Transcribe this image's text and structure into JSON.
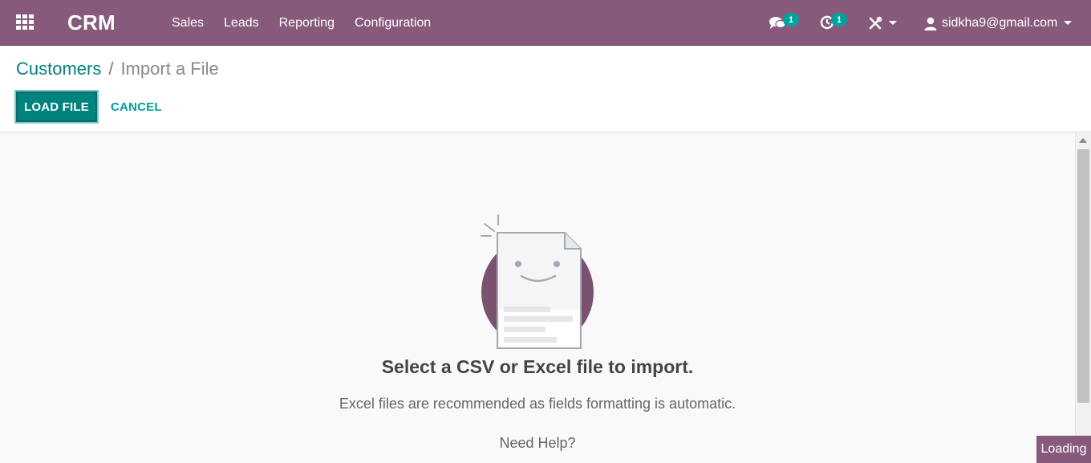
{
  "app": {
    "brand": "CRM",
    "menu": [
      "Sales",
      "Leads",
      "Reporting",
      "Configuration"
    ]
  },
  "systray": {
    "messages_count": "1",
    "activities_count": "1",
    "user_email": "sidkha9@gmail.com",
    "icons": [
      "chat-icon",
      "clock-icon",
      "tools-icon",
      "user-icon"
    ]
  },
  "breadcrumb": {
    "parent": "Customers",
    "separator": "/",
    "current": "Import a File"
  },
  "buttons": {
    "load_file": "LOAD FILE",
    "cancel": "CANCEL"
  },
  "empty_state": {
    "title": "Select a CSV or Excel file to import.",
    "subtitle": "Excel files are recommended as fields formatting is automatic.",
    "help": "Need Help?"
  },
  "status": {
    "loading": "Loading"
  },
  "colors": {
    "navbar": "#875a7b",
    "accent": "#00827f",
    "badge": "#00a09d"
  }
}
